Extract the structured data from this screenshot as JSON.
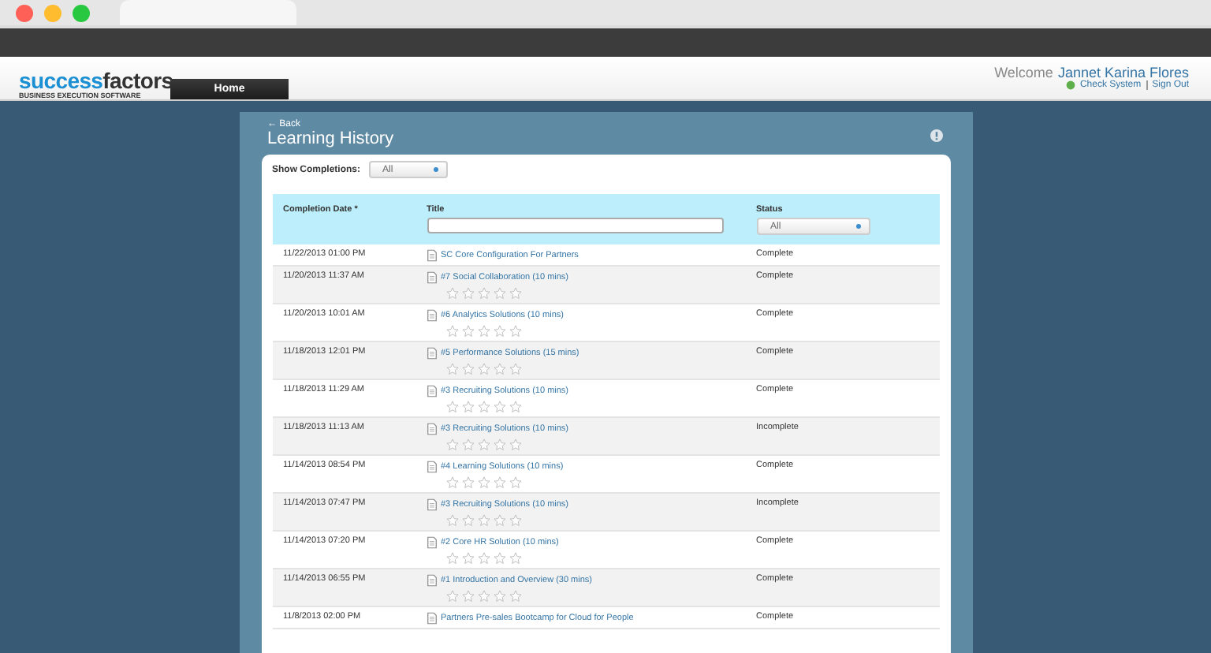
{
  "header": {
    "logo": {
      "part_1": "success",
      "part_2": "factors",
      "tagline": "BUSINESS EXECUTION SOFTWARE"
    },
    "nav_tabs": [
      {
        "label": "Home",
        "selected": true
      }
    ],
    "welcome": {
      "label": "Welcome",
      "user": "Jannet Karina Flores"
    },
    "links": [
      {
        "label": "Check System",
        "kind": "icon"
      },
      {
        "label": "Sign Out",
        "kind": "plain"
      }
    ]
  },
  "panel": {
    "back": "← Back",
    "title": "Learning History",
    "filter": {
      "label": "Show Completions:",
      "value": "All"
    },
    "table": {
      "columns": [
        {
          "label": "Completion Date *",
          "kind": "plain"
        },
        {
          "label": "Title",
          "kind": "text"
        },
        {
          "label": "Status",
          "kind": "select",
          "value": "All"
        }
      ],
      "rows": [
        {
          "date": "11/22/2013 01:00 PM",
          "title": "SC Core Configuration For Partners",
          "status": "Complete"
        },
        {
          "date": "11/20/2013 11:37 AM",
          "title": "#7 Social Collaboration (10 mins)",
          "status": "Complete",
          "stars": 0
        },
        {
          "date": "11/20/2013 10:01 AM",
          "title": "#6 Analytics Solutions (10 mins)",
          "status": "Complete",
          "stars": 0
        },
        {
          "date": "11/18/2013 12:01 PM",
          "title": "#5 Performance Solutions (15 mins)",
          "status": "Complete",
          "stars": 0
        },
        {
          "date": "11/18/2013 11:29 AM",
          "title": "#3 Recruiting Solutions (10 mins)",
          "status": "Complete",
          "stars": 0
        },
        {
          "date": "11/18/2013 11:13 AM",
          "title": "#3 Recruiting Solutions (10 mins)",
          "status": "Incomplete",
          "stars": 0
        },
        {
          "date": "11/14/2013 08:54 PM",
          "title": "#4 Learning Solutions (10 mins)",
          "status": "Complete",
          "stars": 0
        },
        {
          "date": "11/14/2013 07:47 PM",
          "title": "#3 Recruiting Solutions (10 mins)",
          "status": "Incomplete",
          "stars": 0
        },
        {
          "date": "11/14/2013 07:20 PM",
          "title": "#2 Core HR Solution (10 mins)",
          "status": "Complete",
          "stars": 0
        },
        {
          "date": "11/14/2013 06:55 PM",
          "title": "#1 Introduction and Overview (30 mins)",
          "status": "Complete",
          "stars": 0
        },
        {
          "date": "11/8/2013 02:00 PM",
          "title": "Partners Pre-sales Bootcamp for Cloud for People",
          "status": "Complete"
        }
      ]
    }
  }
}
